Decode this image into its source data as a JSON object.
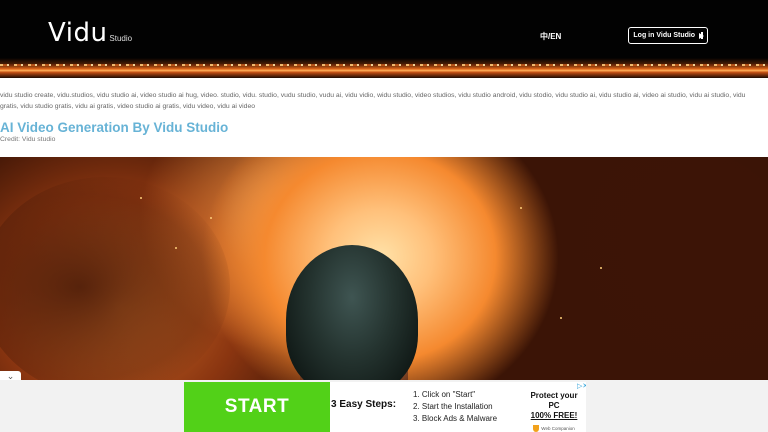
{
  "header": {
    "logo": "Vidu",
    "logo_sub": "Studio",
    "lang_toggle": "中/EN",
    "login_label": "Log in Vidu Studio"
  },
  "content": {
    "keywords": "vidu studio create, vidu.studios, vidu studio ai, video studio ai hug, video. studio, vidu. studio, vudu studio, vudu ai, vidu vidio, widu studio, video studios, vidu studio android, vidu stodio, vidu studio ai, vidu studio ai, video ai studio, vidu ai studio, vidu gratis, vidu studio gratis, vidu ai gratis, video studio ai gratis, vidu video, vidu ai video",
    "title": "AI Video Generation By Vidu Studio",
    "credit": "Credit: Vidu studio"
  },
  "ad": {
    "cta": "START",
    "steps_title": "3 Easy Steps:",
    "steps": [
      "1. Click on \"Start\"",
      "2. Start the Installation",
      "3. Block Ads & Malware"
    ],
    "headline": "Protect your PC",
    "subline": "100% FREE!",
    "brand": "Web Companion",
    "adchoices": "▷✕"
  },
  "colors": {
    "title_blue": "#67b3d6",
    "ad_green": "#52d118",
    "header_bg": "#020202"
  },
  "icons": {
    "login": "play-icon",
    "collapse": "chevron-down-icon",
    "ad_brand": "shield-icon"
  }
}
